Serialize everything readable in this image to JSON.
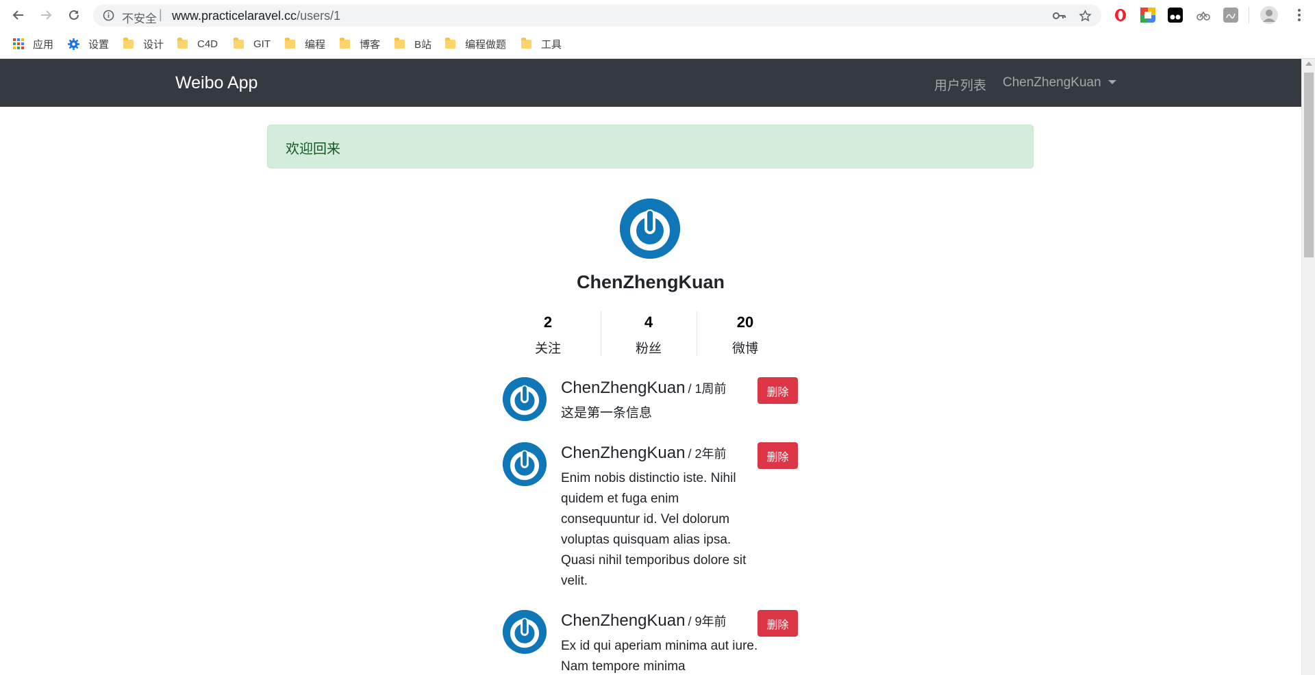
{
  "browser": {
    "security_label": "不安全",
    "url_host": "www.practicelaravel.cc",
    "url_path": "/users/1",
    "bookmarks": [
      {
        "label": "应用"
      },
      {
        "label": "设置"
      },
      {
        "label": "设计"
      },
      {
        "label": "C4D"
      },
      {
        "label": "GIT"
      },
      {
        "label": "编程"
      },
      {
        "label": "博客"
      },
      {
        "label": "B站"
      },
      {
        "label": "编程做题"
      },
      {
        "label": "工具"
      }
    ]
  },
  "navbar": {
    "brand": "Weibo App",
    "users_link": "用户列表",
    "current_user": "ChenZhengKuan"
  },
  "alert": {
    "message": "欢迎回来"
  },
  "profile": {
    "name": "ChenZhengKuan",
    "stats": [
      {
        "value": "2",
        "label": "关注"
      },
      {
        "value": "4",
        "label": "粉丝"
      },
      {
        "value": "20",
        "label": "微博"
      }
    ]
  },
  "statuses": [
    {
      "user": "ChenZhengKuan",
      "time": "/ 1周前",
      "text": "这是第一条信息",
      "delete_label": "删除"
    },
    {
      "user": "ChenZhengKuan",
      "time": "/ 2年前",
      "text": "Enim nobis distinctio iste. Nihil quidem et fuga enim consequuntur id. Vel dolorum voluptas quisquam alias ipsa. Quasi nihil temporibus dolore sit velit.",
      "delete_label": "删除"
    },
    {
      "user": "ChenZhengKuan",
      "time": "/ 9年前",
      "text": "Ex id qui aperiam minima aut iure. Nam tempore minima",
      "delete_label": "删除"
    }
  ]
}
